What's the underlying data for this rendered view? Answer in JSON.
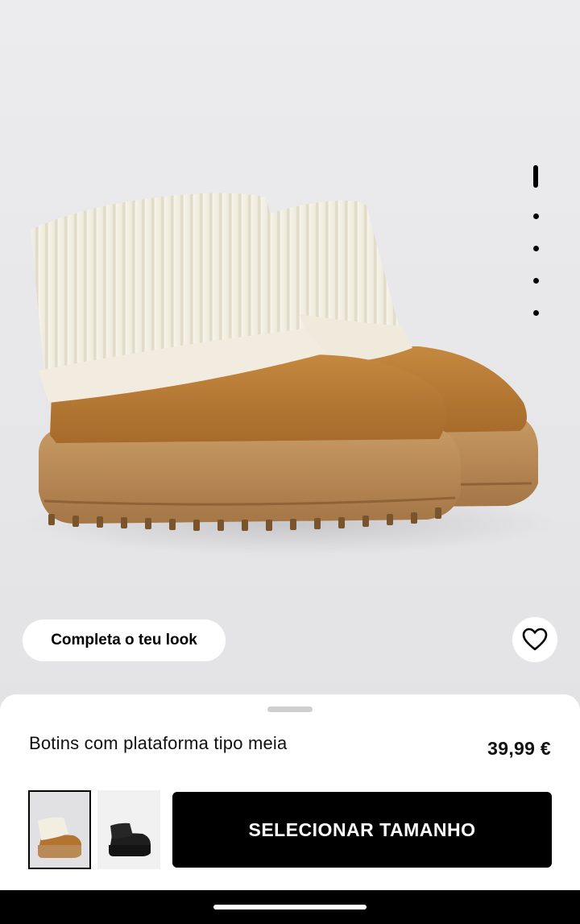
{
  "product": {
    "name": "Botins com plataforma tipo meia",
    "price": "39,99 €"
  },
  "gallery": {
    "page_count": 5,
    "active_index": 0
  },
  "actions": {
    "complete_look_label": "Completa o teu look",
    "select_size_label": "SELECIONAR TAMANHO",
    "favorite_icon": "heart-outline-icon"
  },
  "variants": [
    {
      "color_swatch": "#b8793a",
      "selected": true
    },
    {
      "color_swatch": "#111111",
      "selected": false
    }
  ],
  "colors": {
    "suede": "#b97a3b",
    "sole": "#b98a55",
    "knit": "#f3efe3",
    "button": "#000000"
  }
}
